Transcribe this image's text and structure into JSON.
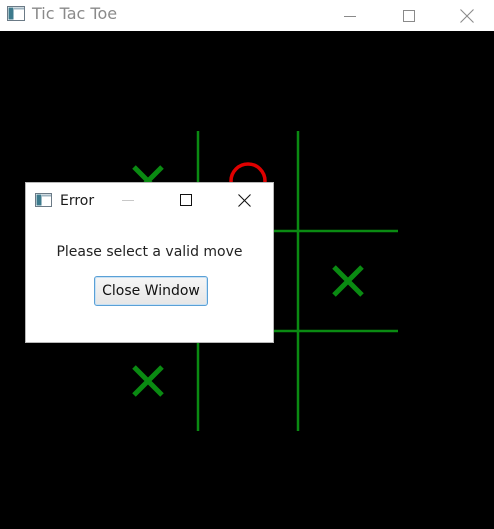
{
  "window": {
    "title": "Tic Tac Toe",
    "icon": "app-window-icon",
    "controls": [
      "minimize-icon",
      "maximize-icon",
      "close-icon"
    ]
  },
  "board": {
    "background": "#000000",
    "grid_color": "#0a8a12",
    "x_color": "#0a8a12",
    "o_color": "#e00000",
    "cells": [
      [
        "X",
        "O",
        ""
      ],
      [
        "",
        "",
        "X"
      ],
      [
        "X",
        "",
        ""
      ]
    ]
  },
  "dialog": {
    "title": "Error",
    "message": "Please select a valid move",
    "button_label": "Close Window",
    "icon": "app-window-icon",
    "controls": [
      "minimize-icon",
      "maximize-icon",
      "close-icon"
    ]
  }
}
